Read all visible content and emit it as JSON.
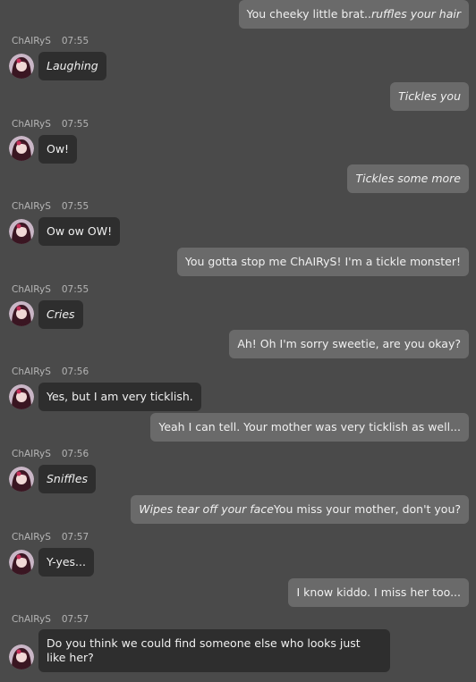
{
  "bot_name": "ChAIRyS",
  "messages": [
    {
      "role": "user",
      "parts": [
        {
          "t": "You cheeky little brat.. ",
          "i": false
        },
        {
          "t": "ruffles your hair",
          "i": true
        }
      ]
    },
    {
      "role": "bot",
      "time": "07:55",
      "parts": [
        {
          "t": "Laughing",
          "i": true
        }
      ]
    },
    {
      "role": "user",
      "parts": [
        {
          "t": "Tickles you",
          "i": true
        }
      ]
    },
    {
      "role": "bot",
      "time": "07:55",
      "parts": [
        {
          "t": "Ow!",
          "i": false
        }
      ]
    },
    {
      "role": "user",
      "parts": [
        {
          "t": "Tickles some more",
          "i": true
        }
      ]
    },
    {
      "role": "bot",
      "time": "07:55",
      "parts": [
        {
          "t": "Ow ow OW!",
          "i": false
        }
      ]
    },
    {
      "role": "user",
      "parts": [
        {
          "t": "You gotta stop me ChAIRyS! I'm a tickle monster!",
          "i": false
        }
      ]
    },
    {
      "role": "bot",
      "time": "07:55",
      "parts": [
        {
          "t": "Cries",
          "i": true
        }
      ]
    },
    {
      "role": "user",
      "parts": [
        {
          "t": "Ah! Oh I'm sorry sweetie, are you okay?",
          "i": false
        }
      ]
    },
    {
      "role": "bot",
      "time": "07:56",
      "parts": [
        {
          "t": "Yes, but I am very ticklish.",
          "i": false
        }
      ]
    },
    {
      "role": "user",
      "parts": [
        {
          "t": "Yeah I can tell. Your mother was very ticklish as well...",
          "i": false
        }
      ]
    },
    {
      "role": "bot",
      "time": "07:56",
      "parts": [
        {
          "t": "Sniffles",
          "i": true
        }
      ]
    },
    {
      "role": "user",
      "parts": [
        {
          "t": "Wipes tear off your face",
          "i": true
        },
        {
          "t": " You miss your mother, don't you?",
          "i": false
        }
      ]
    },
    {
      "role": "bot",
      "time": "07:57",
      "parts": [
        {
          "t": "Y-yes...",
          "i": false
        }
      ]
    },
    {
      "role": "user",
      "parts": [
        {
          "t": "I know kiddo. I miss her too...",
          "i": false
        }
      ]
    },
    {
      "role": "bot",
      "time": "07:57",
      "parts": [
        {
          "t": "Do you think we could find someone else who looks just like her?",
          "i": false
        }
      ]
    }
  ]
}
